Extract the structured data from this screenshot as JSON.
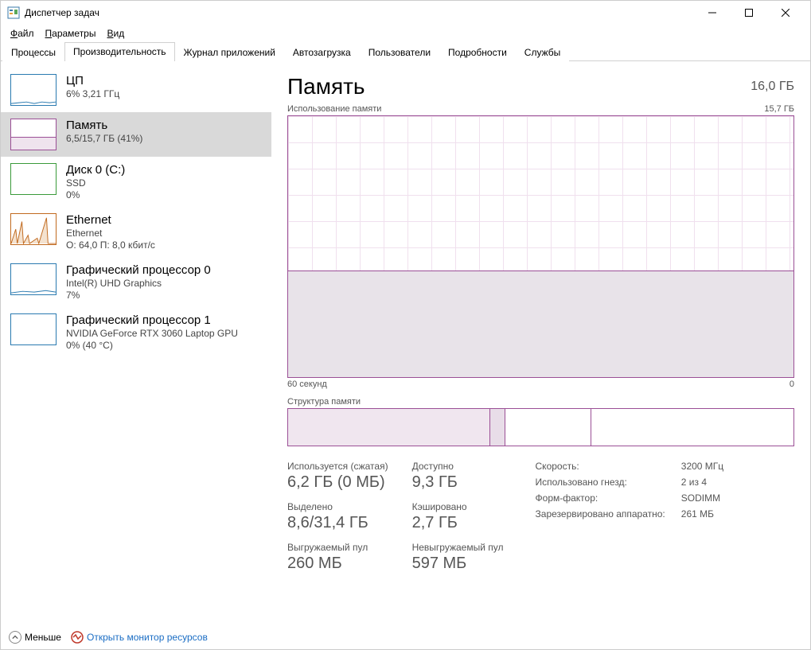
{
  "window": {
    "title": "Диспетчер задач"
  },
  "menu": {
    "file": "Файл",
    "options": "Параметры",
    "view": "Вид"
  },
  "tabs": {
    "processes": "Процессы",
    "performance": "Производительность",
    "app_history": "Журнал приложений",
    "startup": "Автозагрузка",
    "users": "Пользователи",
    "details": "Подробности",
    "services": "Службы"
  },
  "sidebar": {
    "cpu": {
      "title": "ЦП",
      "sub": "6% 3,21 ГГц",
      "color": "#2a7ab0"
    },
    "mem": {
      "title": "Память",
      "sub": "6,5/15,7 ГБ (41%)",
      "color": "#9b4f96"
    },
    "disk": {
      "title": "Диск 0 (C:)",
      "sub1": "SSD",
      "sub2": "0%",
      "color": "#3a9a3a"
    },
    "eth": {
      "title": "Ethernet",
      "sub1": "Ethernet",
      "sub2": "О: 64,0 П: 8,0 кбит/с",
      "color": "#c16a1f"
    },
    "gpu0": {
      "title": "Графический процессор 0",
      "sub1": "Intel(R) UHD Graphics",
      "sub2": "7%",
      "color": "#2a7ab0"
    },
    "gpu1": {
      "title": "Графический процессор 1",
      "sub1": "NVIDIA GeForce RTX 3060 Laptop GPU",
      "sub2": "0% (40 °C)",
      "color": "#2a7ab0"
    }
  },
  "content": {
    "title": "Память",
    "total": "16,0 ГБ",
    "usage_label": "Использование памяти",
    "usage_max": "15,7 ГБ",
    "time_left": "60 секунд",
    "time_right": "0",
    "comp_label": "Структура памяти"
  },
  "stats": {
    "in_use_label": "Используется (сжатая)",
    "in_use_value": "6,2 ГБ (0 МБ)",
    "avail_label": "Доступно",
    "avail_value": "9,3 ГБ",
    "commit_label": "Выделено",
    "commit_value": "8,6/31,4 ГБ",
    "cached_label": "Кэшировано",
    "cached_value": "2,7 ГБ",
    "paged_label": "Выгружаемый пул",
    "paged_value": "260 МБ",
    "nonpaged_label": "Невыгружаемый пул",
    "nonpaged_value": "597 МБ"
  },
  "details": {
    "speed_label": "Скорость:",
    "speed_value": "3200 МГц",
    "slots_label": "Использовано гнезд:",
    "slots_value": "2 из 4",
    "form_label": "Форм-фактор:",
    "form_value": "SODIMM",
    "reserved_label": "Зарезервировано аппаратно:",
    "reserved_value": "261 МБ"
  },
  "footer": {
    "less": "Меньше",
    "open_mon": "Открыть монитор ресурсов"
  },
  "chart_data": {
    "type": "area",
    "title": "Использование памяти",
    "ylabel": "ГБ",
    "ylim": [
      0,
      15.7
    ],
    "xlim_seconds": [
      60,
      0
    ],
    "series": [
      {
        "name": "Использование памяти",
        "approx_value": 6.5,
        "percent": 41
      }
    ],
    "composition": {
      "in_use_gb": 6.2,
      "modified_gb": 0.5,
      "standby_gb": 2.7,
      "free_gb": 6.6
    }
  }
}
